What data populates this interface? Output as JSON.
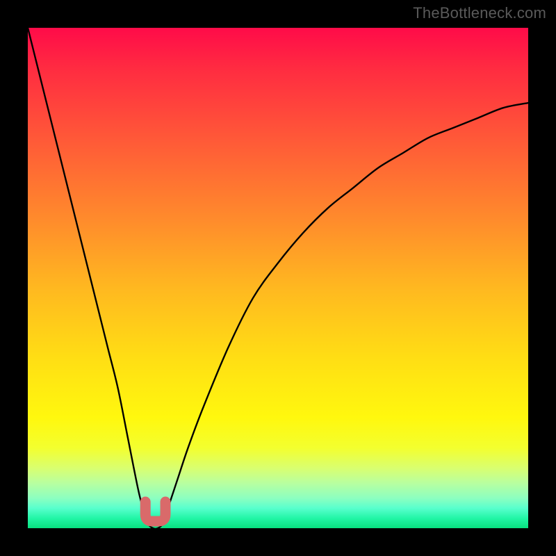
{
  "watermark": {
    "text": "TheBottleneck.com"
  },
  "chart_data": {
    "type": "line",
    "title": "",
    "xlabel": "",
    "ylabel": "",
    "xlim": [
      0,
      100
    ],
    "ylim": [
      0,
      100
    ],
    "grid": false,
    "legend": false,
    "series": [
      {
        "name": "bottleneck-curve",
        "x": [
          0,
          2,
          4,
          6,
          8,
          10,
          12,
          14,
          16,
          18,
          20,
          22,
          23,
          24,
          25,
          26,
          27,
          28,
          30,
          32,
          35,
          40,
          45,
          50,
          55,
          60,
          65,
          70,
          75,
          80,
          85,
          90,
          95,
          100
        ],
        "y": [
          100,
          92,
          84,
          76,
          68,
          60,
          52,
          44,
          36,
          28,
          18,
          8,
          4,
          1,
          0,
          0,
          1,
          4,
          10,
          16,
          24,
          36,
          46,
          53,
          59,
          64,
          68,
          72,
          75,
          78,
          80,
          82,
          84,
          85
        ]
      }
    ],
    "minimum_marker": {
      "x_range": [
        23.5,
        27.5
      ],
      "y": 0,
      "color": "#d96a6a"
    },
    "background_gradient": {
      "direction": "vertical",
      "stops": [
        {
          "pos": 0.0,
          "color": "#ff0b49"
        },
        {
          "pos": 0.22,
          "color": "#ff5838"
        },
        {
          "pos": 0.52,
          "color": "#ffb820"
        },
        {
          "pos": 0.78,
          "color": "#fff80e"
        },
        {
          "pos": 0.94,
          "color": "#8cffc0"
        },
        {
          "pos": 1.0,
          "color": "#08e07f"
        }
      ]
    }
  }
}
